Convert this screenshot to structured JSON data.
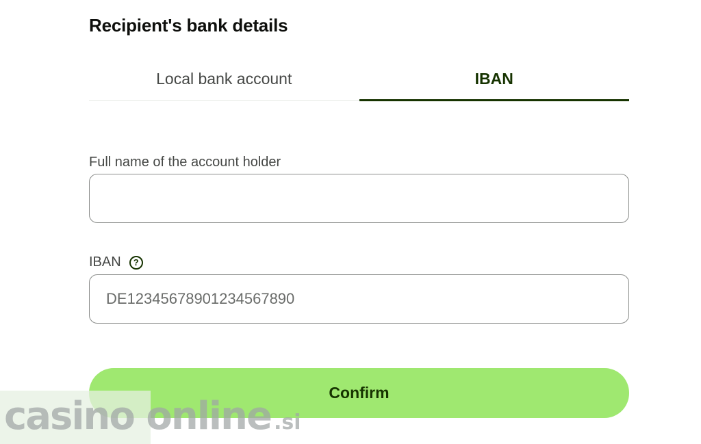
{
  "section": {
    "title": "Recipient's bank details"
  },
  "tabs": [
    {
      "label": "Local bank account",
      "active": false
    },
    {
      "label": "IBAN",
      "active": true
    }
  ],
  "form": {
    "full_name": {
      "label": "Full name of the account holder",
      "value": "",
      "placeholder": ""
    },
    "iban": {
      "label": "IBAN",
      "help_icon": "question-circle-icon",
      "value": "",
      "placeholder": "DE12345678901234567890"
    }
  },
  "confirm_label": "Confirm",
  "watermark": {
    "main": "casino online",
    "tld": ".si"
  },
  "colors": {
    "accent": "#9fe870",
    "text_dark": "#163300",
    "border": "#8a8c8a"
  }
}
